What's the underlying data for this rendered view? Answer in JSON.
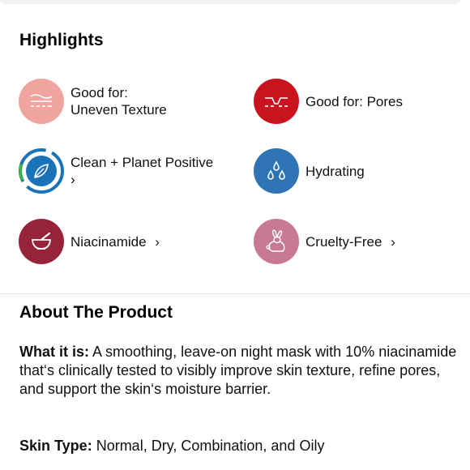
{
  "highlights": {
    "title": "Highlights",
    "items": [
      {
        "line1": "Good for:",
        "line2": "Uneven Texture",
        "color": "#f0a4a0",
        "icon": "texture-layers-icon"
      },
      {
        "line1": "Good for: Pores",
        "color": "#c9141f",
        "icon": "pores-icon"
      },
      {
        "line1": "Clean + Planet Positive",
        "line2": "›",
        "color": "#1a73b8",
        "icon": "clean-planet-positive-icon"
      },
      {
        "line1": "Hydrating",
        "color": "#2f74b5",
        "icon": "water-drops-icon"
      },
      {
        "line1": "Niacinamide",
        "chevron": "›",
        "color": "#972339",
        "icon": "mortar-pestle-icon"
      },
      {
        "line1": "Cruelty-Free",
        "chevron": "›",
        "color": "#c97a92",
        "icon": "bunny-icon"
      }
    ]
  },
  "about": {
    "title": "About The Product",
    "what_label": "What it is:",
    "what_text": " A smoothing, leave-on night mask with 10% niacinamide that‘s clinically tested to visibly improve skin texture, refine pores, and support the skin‘s moisture barrier.",
    "skin_label": "Skin Type:",
    "skin_text": " Normal, Dry, Combination, and Oily"
  }
}
